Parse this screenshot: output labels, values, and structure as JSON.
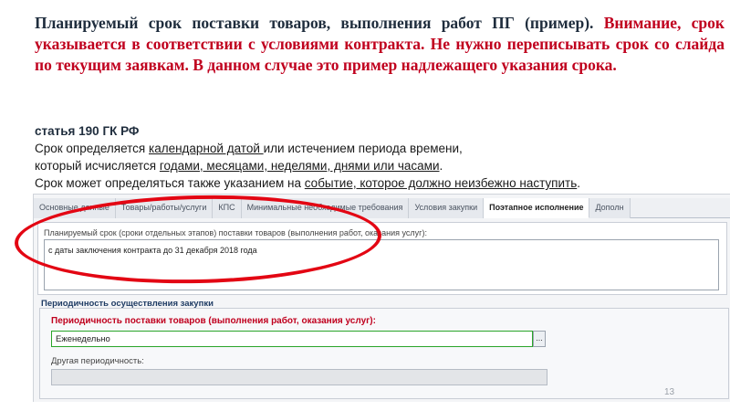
{
  "heading": {
    "dark": "Планируемый срок поставки товаров, выполнения работ ПГ (пример).",
    "red": "Внимание, срок указывается в соответствии с условиями контракта. Не нужно переписывать срок со слайда по текущим заявкам. В данном случае это пример надлежащего указания срока."
  },
  "article": {
    "title": "статья 190 ГК РФ",
    "l1a": "Срок определяется ",
    "l1b": "календарной датой ",
    "l1c": "или истечением периода времени,",
    "l2a": "который исчисляется ",
    "l2b": "годами, месяцами, неделями, днями или часами",
    "l2c": ".",
    "l3a": "Срок может определяться также указанием на ",
    "l3b": "событие, которое должно неизбежно наступить",
    "l3c": "."
  },
  "tabs": [
    "Основные данные",
    "Товары/работы/услуги",
    "КПС",
    "Минимальные необходимые требования",
    "Условия закупки",
    "Поэтапное исполнение",
    "Дополн"
  ],
  "form": {
    "planned_label": "Планируемый срок (сроки отдельных этапов) поставки товаров (выполнения работ, оказания услуг):",
    "planned_value": "с даты заключения контракта до 31 декабря 2018 года",
    "group_title": "Периодичность осуществления закупки",
    "period_label": "Периодичность поставки товаров (выполнения работ, оказания услуг):",
    "period_value": "Еженедельно",
    "period_btn": "...",
    "other_label": "Другая периодичность:"
  },
  "slide_number": "13",
  "colors": {
    "accent_red": "#c0001e",
    "ellipse_red": "#e30613",
    "active_field_border": "#2aa52a"
  }
}
